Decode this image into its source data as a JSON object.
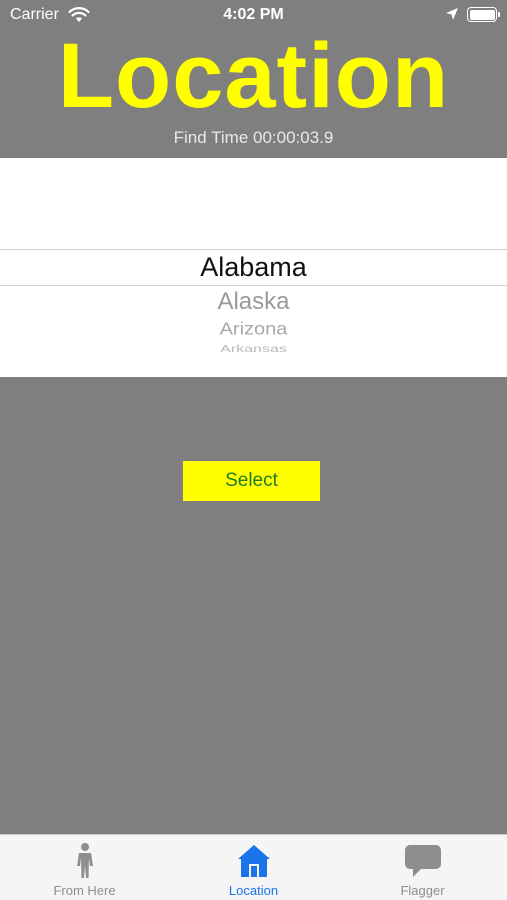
{
  "status_bar": {
    "carrier": "Carrier",
    "time": "4:02 PM"
  },
  "header": {
    "title": "Location",
    "find_time": "Find Time 00:00:03.9"
  },
  "picker": {
    "selected": "Alabama",
    "items_below": [
      "Alaska",
      "Arizona",
      "Arkansas"
    ]
  },
  "select_button": {
    "label": "Select"
  },
  "tab_bar": {
    "tabs": [
      {
        "label": "From Here",
        "icon": "person-icon",
        "active": false
      },
      {
        "label": "Location",
        "icon": "house-icon",
        "active": true
      },
      {
        "label": "Flagger",
        "icon": "speech-bubble-icon",
        "active": false
      }
    ]
  },
  "colors": {
    "background": "#7f7f7f",
    "title": "#ffff00",
    "button_bg": "#ffff00",
    "button_text": "#1e7d1e",
    "tab_active": "#1a73e8",
    "tab_inactive": "#8e8e8e"
  }
}
